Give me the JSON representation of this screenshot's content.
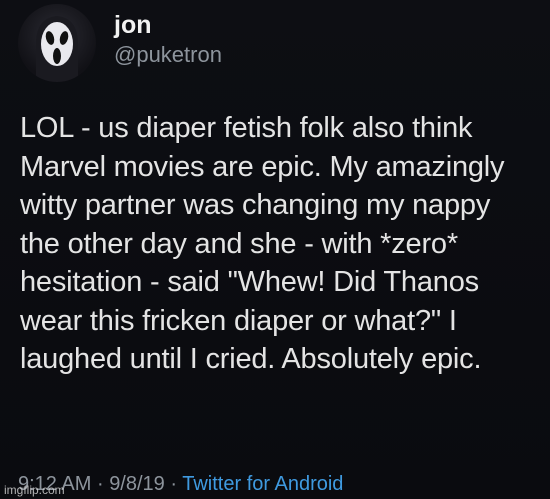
{
  "tweet": {
    "display_name": "jon",
    "handle": "@puketron",
    "avatar_icon": "ghostface-mask-avatar",
    "text": "LOL - us diaper fetish folk also think\nMarvel movies are epic. My amazingly\nwitty partner was changing my nappy\nthe other day and she - with *zero*\nhesitation - said \"Whew! Did Thanos\nwear this fricken diaper or what?\" I\nlaughed until I cried. Absolutely epic.",
    "time": "9:12 AM",
    "separator": "·",
    "date": "9/8/19",
    "source": "Twitter for Android"
  },
  "watermark": "imgflip.com",
  "colors": {
    "background": "#0b0c10",
    "text": "#e4e4e4",
    "muted": "#8d949c",
    "link": "#3f9ae0"
  }
}
